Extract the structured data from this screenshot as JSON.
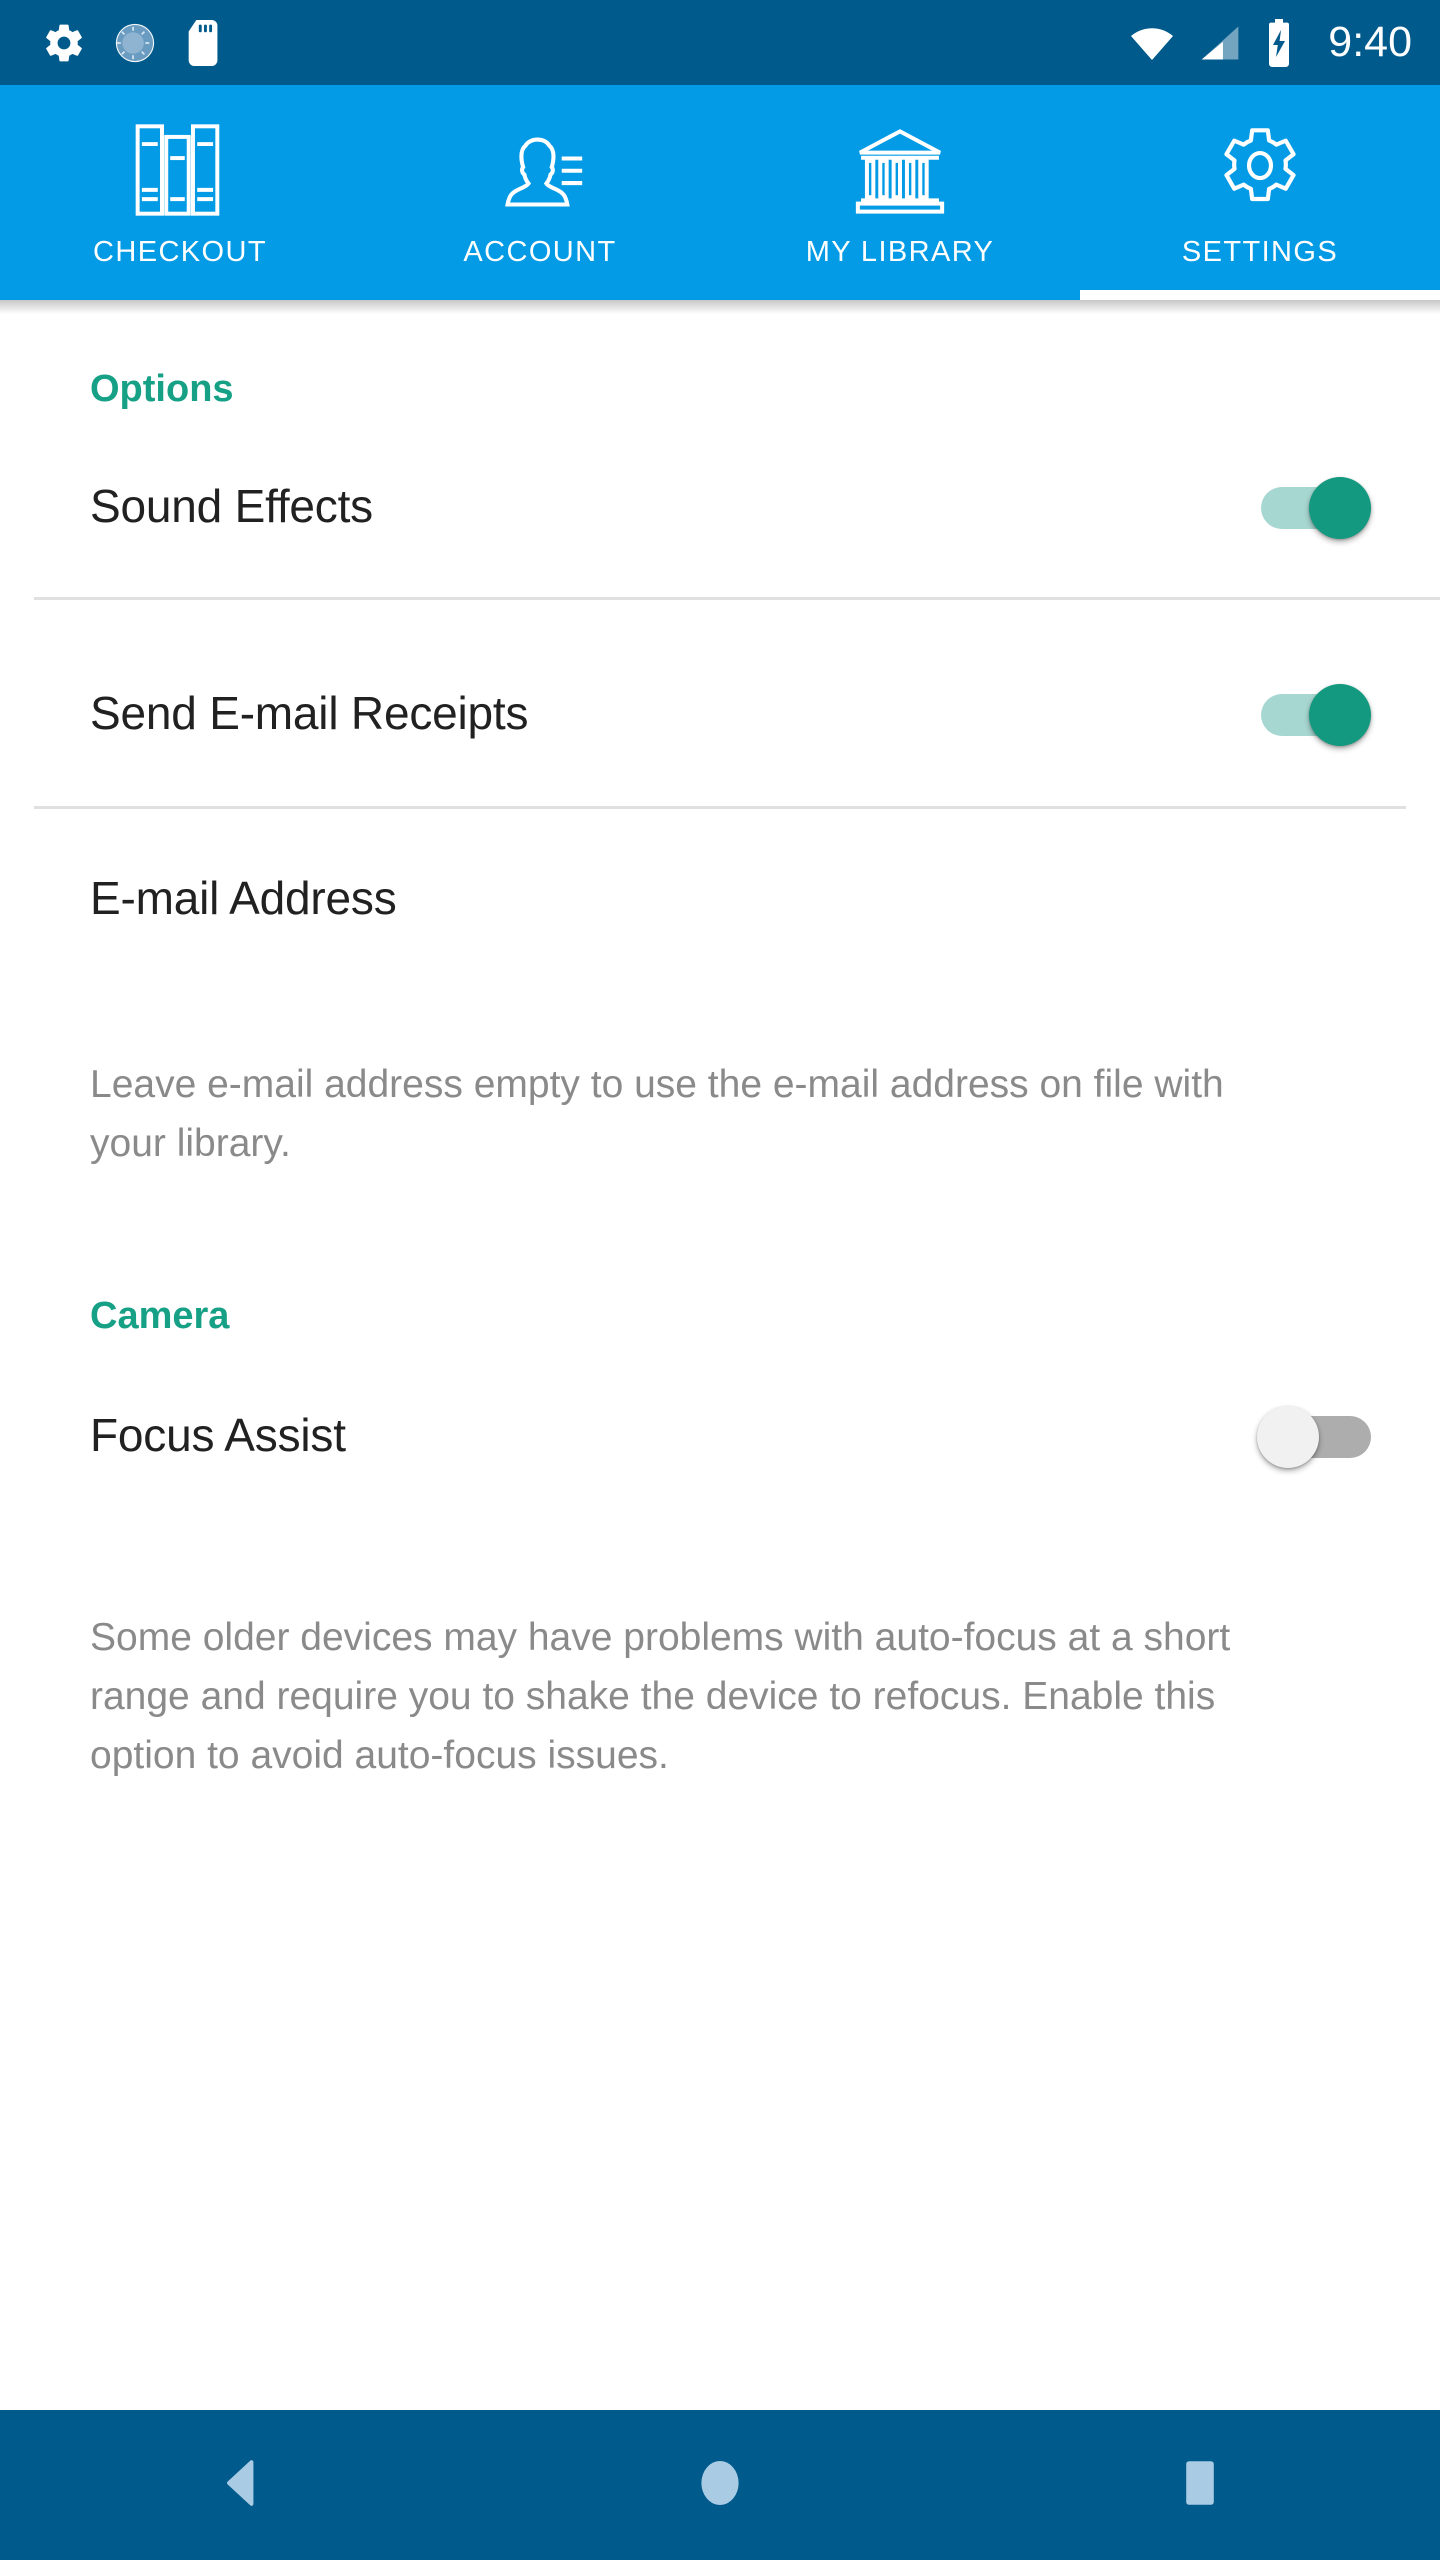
{
  "status_bar": {
    "time": "9:40",
    "left_icons": [
      "gear-icon",
      "brightness-icon",
      "sd-card-icon"
    ],
    "right_icons": [
      "wifi-icon",
      "cell-signal-icon",
      "battery-charging-icon"
    ],
    "background": "#005A8C"
  },
  "tabbar": {
    "background": "#039BE5",
    "selected_index": 3,
    "tabs": [
      {
        "label": "CHECKOUT",
        "icon": "books-icon"
      },
      {
        "label": "ACCOUNT",
        "icon": "person-lines-icon"
      },
      {
        "label": "MY LIBRARY",
        "icon": "library-building-icon"
      },
      {
        "label": "SETTINGS",
        "icon": "gear-icon"
      }
    ]
  },
  "settings": {
    "accent_color": "#16A085",
    "sections": [
      {
        "header": "Options",
        "rows": [
          {
            "title": "Sound Effects",
            "type": "switch",
            "state": "on"
          },
          {
            "title": "Send E-mail Receipts",
            "type": "switch",
            "state": "on"
          }
        ],
        "field": {
          "label": "E-mail Address",
          "value": "",
          "placeholder": "E-mail Address"
        },
        "help": "Leave e-mail address empty to use the e-mail address on file with your library."
      },
      {
        "header": "Camera",
        "rows": [
          {
            "title": "Focus Assist",
            "type": "switch",
            "state": "off"
          }
        ],
        "help": "Some older devices may have problems with auto-focus at a short range and require you to shake the device to refocus. Enable this option to avoid auto-focus issues."
      }
    ]
  },
  "navbar": {
    "background": "#005A8C",
    "buttons": [
      {
        "name": "back",
        "icon": "back-triangle-icon"
      },
      {
        "name": "home",
        "icon": "home-circle-icon"
      },
      {
        "name": "recents",
        "icon": "recents-square-icon"
      }
    ]
  }
}
